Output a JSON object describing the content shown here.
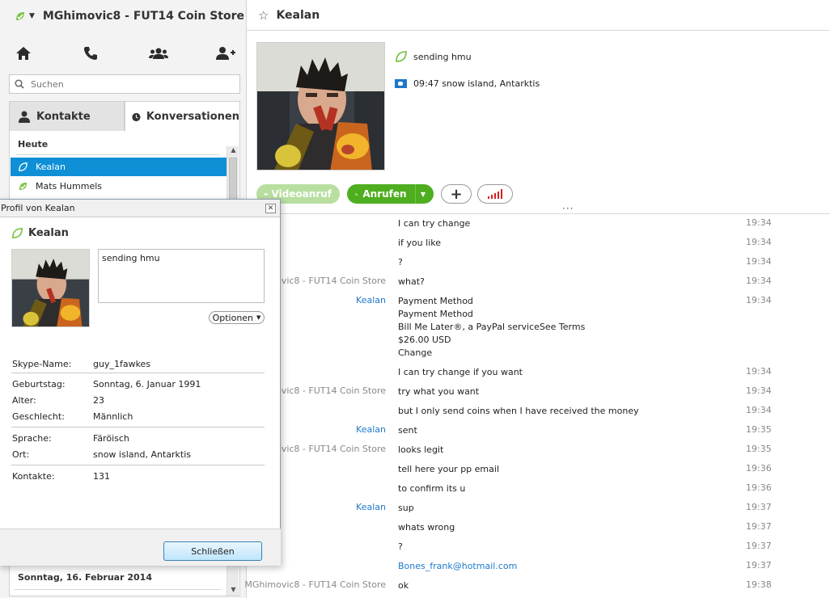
{
  "account": {
    "name": "MGhimovic8 - FUT14 Coin Store",
    "status_icon": "online-leaf-icon"
  },
  "nav": {
    "icons": [
      "home-icon",
      "phone-icon",
      "group-icon",
      "add-contact-icon"
    ]
  },
  "search": {
    "placeholder": "Suchen"
  },
  "tabs": {
    "contacts": "Kontakte",
    "conversations": "Konversationen"
  },
  "conversations": {
    "section_today": "Heute",
    "items": [
      {
        "name": "Kealan"
      },
      {
        "name": "Mats Hummels"
      }
    ],
    "section_older": "Sonntag, 16. Februar 2014"
  },
  "chat": {
    "contact_name": "Kealan",
    "mood": "sending hmu",
    "local_time": "09:47 snow island, Antarktis",
    "video_label": "Videoanruf",
    "call_label": "Anrufen",
    "messages": [
      {
        "sender": "",
        "lines": [
          "I can try change"
        ],
        "time": "19:34"
      },
      {
        "sender": "",
        "lines": [
          "if you like"
        ],
        "time": "19:34"
      },
      {
        "sender": "",
        "lines": [
          "?"
        ],
        "time": "19:34"
      },
      {
        "sender": "MGhimovic8 - FUT14 Coin Store",
        "lines": [
          "what?"
        ],
        "time": "19:34"
      },
      {
        "sender": "Kealan",
        "lines": [
          "Payment Method",
          "Payment Method",
          "Bill Me Later®, a PayPal serviceSee Terms",
          "$26.00 USD",
          "Change"
        ],
        "time": "19:34"
      },
      {
        "sender": "",
        "lines": [
          "I can try change if you want"
        ],
        "time": "19:34"
      },
      {
        "sender": "MGhimovic8 - FUT14 Coin Store",
        "lines": [
          "try what you want"
        ],
        "time": "19:34"
      },
      {
        "sender": "",
        "lines": [
          "but I only send coins when I have received the money"
        ],
        "time": "19:34"
      },
      {
        "sender": "Kealan",
        "lines": [
          "sent"
        ],
        "time": "19:35"
      },
      {
        "sender": "MGhimovic8 - FUT14 Coin Store",
        "lines": [
          "looks legit"
        ],
        "time": "19:35"
      },
      {
        "sender": "",
        "lines": [
          "tell here your pp email"
        ],
        "time": "19:36"
      },
      {
        "sender": "",
        "lines": [
          "to confirm its u"
        ],
        "time": "19:36"
      },
      {
        "sender": "Kealan",
        "lines": [
          "sup"
        ],
        "time": "19:37"
      },
      {
        "sender": "",
        "lines": [
          "whats wrong"
        ],
        "time": "19:37"
      },
      {
        "sender": "",
        "lines": [
          "?"
        ],
        "time": "19:37"
      },
      {
        "sender": "",
        "lines": [
          "Bones_frank@hotmail.com"
        ],
        "time": "19:37",
        "is_link": true
      },
      {
        "sender": "MGhimovic8 - FUT14 Coin Store",
        "lines": [
          "ok"
        ],
        "time": "19:38"
      }
    ]
  },
  "profile": {
    "window_title": "Profil von Kealan",
    "name": "Kealan",
    "mood": "sending hmu",
    "options_label": "Optionen",
    "fields": {
      "skype_name": {
        "label": "Skype-Name:",
        "value": "guy_1fawkes"
      },
      "birthday": {
        "label": "Geburtstag:",
        "value": "Sonntag, 6. Januar 1991"
      },
      "age": {
        "label": "Alter:",
        "value": "23"
      },
      "gender": {
        "label": "Geschlecht:",
        "value": "Männlich"
      },
      "language": {
        "label": "Sprache:",
        "value": "Färöisch"
      },
      "location": {
        "label": "Ort:",
        "value": "snow island, Antarktis"
      },
      "contacts": {
        "label": "Kontakte:",
        "value": "131"
      }
    },
    "close_label": "Schließen"
  },
  "colors": {
    "accent_blue": "#0f8fd6",
    "call_green": "#4fae1f",
    "link_blue": "#1d7ac9"
  }
}
